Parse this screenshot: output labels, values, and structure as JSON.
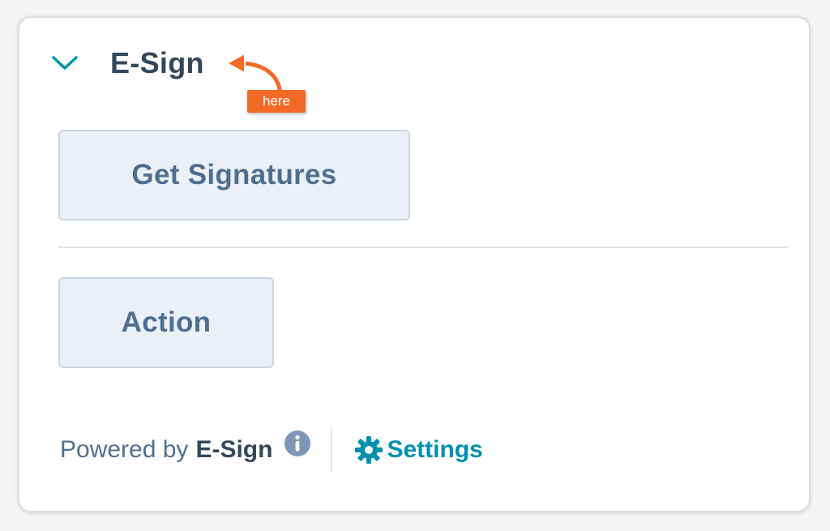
{
  "panel": {
    "title": "E-Sign",
    "annotation_label": "here"
  },
  "actions": {
    "get_signatures_label": "Get Signatures",
    "action_label": "Action"
  },
  "footer": {
    "powered_by_text": "Powered by",
    "brand_name": "E-Sign",
    "settings_label": "Settings"
  },
  "icons": {
    "collapse": "chevron-down-icon",
    "info": "info-icon",
    "settings": "gear-icon"
  },
  "colors": {
    "title": "#33475b",
    "button_bg": "#eaf0f6",
    "button_border": "#cbd6e2",
    "button_text": "#506e91",
    "link": "#0091ae",
    "annotation": "#f26a28",
    "chevron": "#0091ae"
  }
}
